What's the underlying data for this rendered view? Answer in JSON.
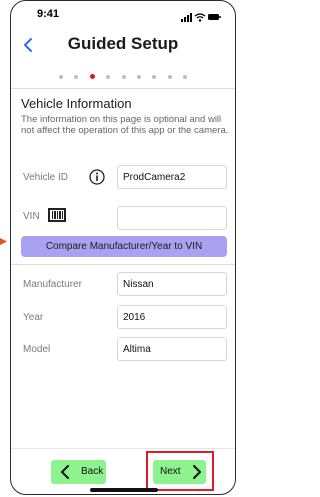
{
  "status_bar": {
    "time": "9:41",
    "icons": [
      "cellular-signal-icon",
      "wifi-icon",
      "battery-icon"
    ]
  },
  "nav": {
    "title": "Guided Setup",
    "back_icon": "chevron-left-icon"
  },
  "progress": {
    "total_steps": 9,
    "current_step": 3,
    "active_color": "#d21c1c"
  },
  "section": {
    "title": "Vehicle Information",
    "description": "The information on this page is optional and will not affect the operation of this app or the camera."
  },
  "fields": {
    "vehicle_id": {
      "label": "Vehicle ID",
      "value": "ProdCamera2"
    },
    "vin": {
      "label": "VIN",
      "value": ""
    },
    "manufacturer": {
      "label": "Manufacturer",
      "value": "Nissan"
    },
    "year": {
      "label": "Year",
      "value": "2016"
    },
    "model": {
      "label": "Model",
      "value": "Altima"
    }
  },
  "compare_button": {
    "label": "Compare Manufacturer/Year to VIN",
    "color": "#a9a2f2"
  },
  "footer": {
    "back_label": "Back",
    "next_label": "Next",
    "button_color": "#8ef28f",
    "highlight_color": "#d61f26"
  }
}
